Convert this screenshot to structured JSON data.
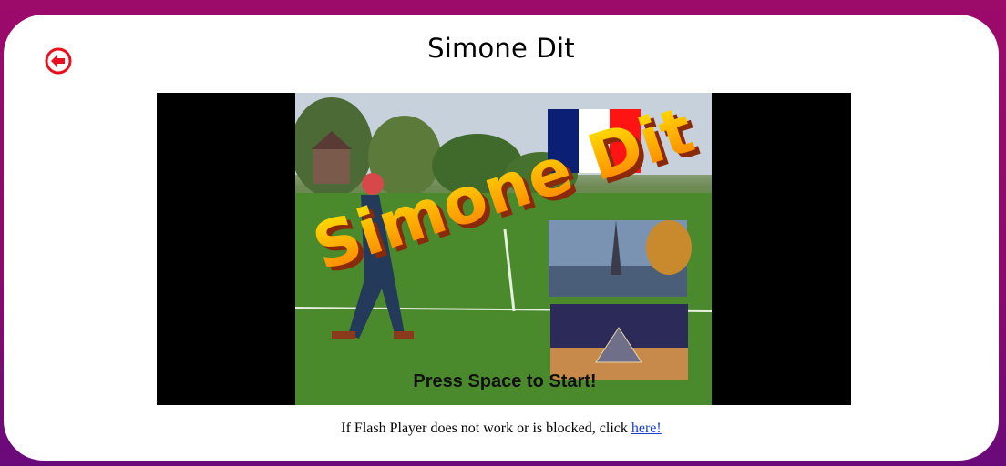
{
  "header": {
    "title": "Simone Dit",
    "back_icon": "back-arrow-icon"
  },
  "game": {
    "logo_text": "Simone Dit",
    "prompt": "Press Space to Start!",
    "flag_colors": [
      "#0b1f74",
      "#ffffff",
      "#ff1414"
    ]
  },
  "fallback": {
    "text": "If Flash Player does not work or is blocked, click ",
    "link_label": "here!"
  },
  "colors": {
    "accent": "#e8101e",
    "background": "#9c0a6a"
  }
}
